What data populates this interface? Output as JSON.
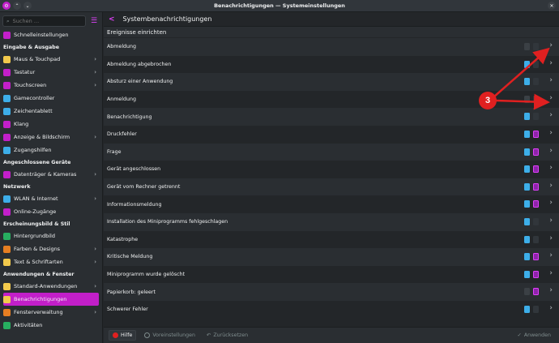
{
  "window": {
    "title": "Benachrichtigungen — Systemeinstellungen"
  },
  "sidebar": {
    "search_placeholder": "Suchen …",
    "top_item": {
      "label": "Schnelleinstellungen",
      "icon": "quick-settings-icon",
      "color": "#c21fc9"
    },
    "sections": [
      {
        "title": "Eingabe & Ausgabe",
        "items": [
          {
            "label": "Maus & Touchpad",
            "icon": "mouse-icon",
            "color": "#f2c94c",
            "chevron": true
          },
          {
            "label": "Tastatur",
            "icon": "keyboard-icon",
            "color": "#c21fc9",
            "chevron": true
          },
          {
            "label": "Touchscreen",
            "icon": "touchscreen-icon",
            "color": "#c21fc9",
            "chevron": true
          },
          {
            "label": "Gamecontroller",
            "icon": "gamepad-icon",
            "color": "#3daee9",
            "chevron": false
          },
          {
            "label": "Zeichentablett",
            "icon": "tablet-icon",
            "color": "#3daee9",
            "chevron": false
          },
          {
            "label": "Klang",
            "icon": "speaker-icon",
            "color": "#c21fc9",
            "chevron": false
          },
          {
            "label": "Anzeige & Bildschirm",
            "icon": "display-icon",
            "color": "#c21fc9",
            "chevron": true
          },
          {
            "label": "Zugangshilfen",
            "icon": "accessibility-icon",
            "color": "#3daee9",
            "chevron": false
          }
        ]
      },
      {
        "title": "Angeschlossene Geräte",
        "items": [
          {
            "label": "Datenträger & Kameras",
            "icon": "drive-icon",
            "color": "#c21fc9",
            "chevron": true
          }
        ]
      },
      {
        "title": "Netzwerk",
        "items": [
          {
            "label": "WLAN & Internet",
            "icon": "wifi-icon",
            "color": "#3daee9",
            "chevron": true
          },
          {
            "label": "Online-Zugänge",
            "icon": "online-accounts-icon",
            "color": "#c21fc9",
            "chevron": false
          }
        ]
      },
      {
        "title": "Erscheinungsbild & Stil",
        "items": [
          {
            "label": "Hintergrundbild",
            "icon": "wallpaper-icon",
            "color": "#27ae60",
            "chevron": false
          },
          {
            "label": "Farben & Designs",
            "icon": "palette-icon",
            "color": "#e67e22",
            "chevron": true
          },
          {
            "label": "Text & Schriftarten",
            "icon": "font-icon",
            "color": "#f2c94c",
            "chevron": true
          }
        ]
      },
      {
        "title": "Anwendungen & Fenster",
        "items": [
          {
            "label": "Standard-Anwendungen",
            "icon": "default-apps-icon",
            "color": "#f2c94c",
            "chevron": true
          },
          {
            "label": "Benachrichtigungen",
            "icon": "bell-icon",
            "color": "#f2c94c",
            "chevron": false,
            "active": true
          },
          {
            "label": "Fensterverwaltung",
            "icon": "window-manager-icon",
            "color": "#e67e22",
            "chevron": true
          },
          {
            "label": "Aktivitäten",
            "icon": "activities-icon",
            "color": "#27ae60",
            "chevron": false
          }
        ]
      }
    ]
  },
  "main": {
    "back_label": "<",
    "title": "Systembenachrichtigungen",
    "list_header": "Ereignisse einrichten",
    "events": [
      {
        "label": "Abmeldung",
        "sound": false,
        "popup": false
      },
      {
        "label": "Abmeldung abgebrochen",
        "sound": true,
        "popup": false
      },
      {
        "label": "Absturz einer Anwendung",
        "sound": true,
        "popup": false
      },
      {
        "label": "Anmeldung",
        "sound": false,
        "popup": false
      },
      {
        "label": "Benachrichtigung",
        "sound": true,
        "popup": false
      },
      {
        "label": "Druckfehler",
        "sound": true,
        "popup": true
      },
      {
        "label": "Frage",
        "sound": true,
        "popup": true
      },
      {
        "label": "Gerät angeschlossen",
        "sound": true,
        "popup": true
      },
      {
        "label": "Gerät vom Rechner getrennt",
        "sound": true,
        "popup": true
      },
      {
        "label": "Informationsmeldung",
        "sound": true,
        "popup": true
      },
      {
        "label": "Installation des Miniprogramms fehlgeschlagen",
        "sound": true,
        "popup": false
      },
      {
        "label": "Katastrophe",
        "sound": true,
        "popup": false
      },
      {
        "label": "Kritische Meldung",
        "sound": true,
        "popup": true
      },
      {
        "label": "Miniprogramm wurde gelöscht",
        "sound": true,
        "popup": true
      },
      {
        "label": "Papierkorb: geleert",
        "sound": false,
        "popup": true
      },
      {
        "label": "Schwerer Fehler",
        "sound": true,
        "popup": false
      }
    ]
  },
  "footer": {
    "help": "Hilfe",
    "defaults": "Voreinstellungen",
    "reset": "Zurücksetzen",
    "apply": "Anwenden"
  },
  "annotation": {
    "badge": "3",
    "color": "#e02020"
  }
}
